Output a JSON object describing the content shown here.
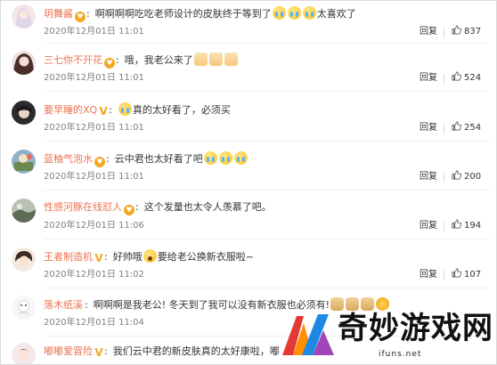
{
  "colors": {
    "username": "#eb7350",
    "badge": "#f5a623",
    "meta": "#808080"
  },
  "comments": [
    {
      "user": "玥舞酱",
      "badge": "heart",
      "text": "啊啊啊啊吃吃老师设计的皮肤终于等到了",
      "emoji_after": [
        "cry",
        "cry",
        "cry"
      ],
      "text2": "太喜欢了",
      "time": "2020年12月01日 11:01",
      "reply": "回复",
      "likes": "837"
    },
    {
      "user": "三七你不开花",
      "badge": "heart",
      "text": "哦，我老公来了",
      "emoji_after": [
        "cat",
        "cat",
        "cat"
      ],
      "text2": "",
      "time": "2020年12月01日 11:01",
      "reply": "回复",
      "likes": "524"
    },
    {
      "user": "要早睡的XQ",
      "badge": "v",
      "text": "",
      "emoji_before": [
        "cry"
      ],
      "text2": "真的太好看了，必须买",
      "time": "2020年12月01日 11:01",
      "reply": "回复",
      "likes": "254"
    },
    {
      "user": "蓝柚气泡水",
      "badge": "heart",
      "text": "云中君也太好看了吧",
      "emoji_after": [
        "cry",
        "cry",
        "cry"
      ],
      "text2": "",
      "time": "2020年12月01日 11:01",
      "reply": "回复",
      "likes": "200"
    },
    {
      "user": "性感河豚在线怼人",
      "badge": "heart",
      "text": "这个发量也太令人羡慕了吧。",
      "emoji_after": [],
      "text2": "",
      "time": "2020年12月01日 11:06",
      "reply": "回复",
      "likes": "194"
    },
    {
      "user": "王者制造机",
      "badge": "v",
      "text": "好帅哦",
      "emoji_after": [
        "shock"
      ],
      "text2": "要给老公换新衣服啦~",
      "time": "2020年12月01日 11:02",
      "reply": "回复",
      "likes": "107"
    },
    {
      "user": "落木纸溪",
      "badge": "",
      "text": "啊啊啊是我老公! 冬天到了我可以没有新衣服也必须有!",
      "emoji_after": [
        "dog",
        "dog",
        "dog",
        "sun"
      ],
      "text2": "",
      "time": "2020年12月01日 11:04",
      "reply": "",
      "likes": ""
    },
    {
      "user": "嘟嘟爱冒险",
      "badge": "v",
      "text": "我们云中君的新皮肤真的太好康啦，嘟",
      "emoji_after": [],
      "text2": "",
      "time": "",
      "reply": "",
      "likes": ""
    }
  ],
  "watermark": {
    "title": "奇妙游戏网",
    "url": "ifuns.net"
  }
}
